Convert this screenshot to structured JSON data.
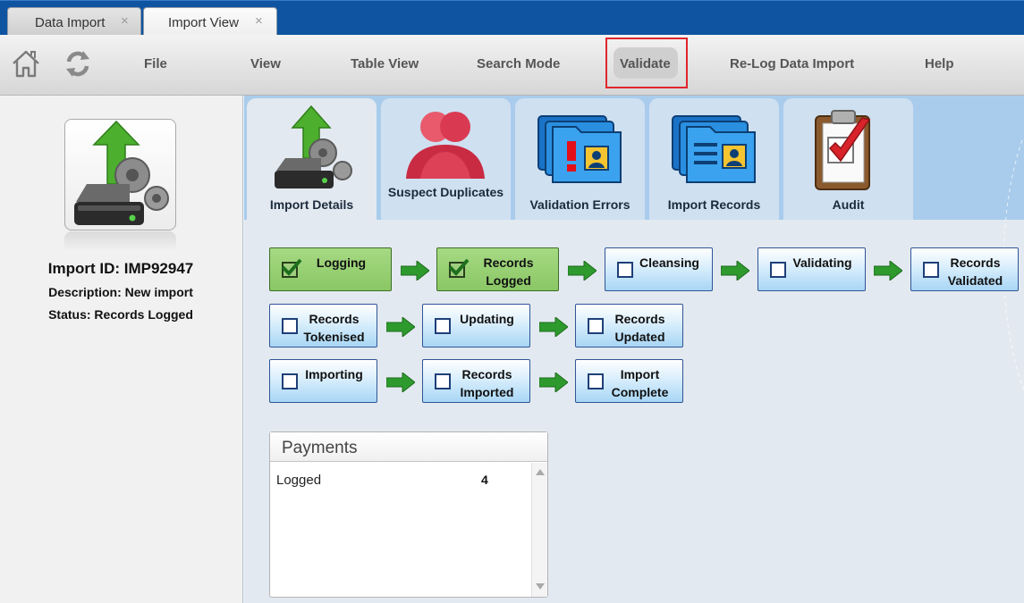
{
  "tabs": [
    {
      "label": "Data Import",
      "close": "×"
    },
    {
      "label": "Import View",
      "close": "×"
    }
  ],
  "toolbar": {
    "home_icon": "home-icon",
    "refresh_icon": "refresh-icon",
    "menu": [
      "File",
      "View",
      "Table View",
      "Search Mode",
      "Validate",
      "Re-Log Data Import",
      "Help"
    ],
    "highlighted": "Validate",
    "highlight_color": "#e0262c"
  },
  "import_info": {
    "id": "Import ID: IMP92947",
    "description": "Description: New import",
    "status": "Status: Records Logged"
  },
  "ribbon_tabs": [
    {
      "label": "Import Details",
      "icon": "import-server-icon",
      "active": true
    },
    {
      "label": "Suspect Duplicates",
      "icon": "duplicate-people-icon",
      "active": false
    },
    {
      "label": "Validation Errors",
      "icon": "validation-error-folder-icon",
      "active": false
    },
    {
      "label": "Import Records",
      "icon": "import-records-folder-icon",
      "active": false
    },
    {
      "label": "Audit",
      "icon": "audit-clipboard-icon",
      "active": false
    }
  ],
  "workflow": [
    {
      "label": "Logging",
      "done": true
    },
    {
      "label": "Records Logged",
      "done": true
    },
    {
      "label": "Cleansing",
      "done": false
    },
    {
      "label": "Validating",
      "done": false
    },
    {
      "label": "Records Validated",
      "done": false
    },
    {
      "label": "Records Tokenised",
      "done": false
    },
    {
      "label": "Updating",
      "done": false
    },
    {
      "label": "Records Updated",
      "done": false
    },
    {
      "label": "Importing",
      "done": false
    },
    {
      "label": "Records Imported",
      "done": false
    },
    {
      "label": "Import Complete",
      "done": false
    }
  ],
  "payments": {
    "title": "Payments",
    "rows": [
      {
        "label": "Logged",
        "value": "4"
      }
    ]
  },
  "colors": {
    "tabstrip": "#0f54a0",
    "step_done": "#8ac765",
    "step_pending": "#a7d6f5",
    "arrow": "#2e9a2e"
  }
}
